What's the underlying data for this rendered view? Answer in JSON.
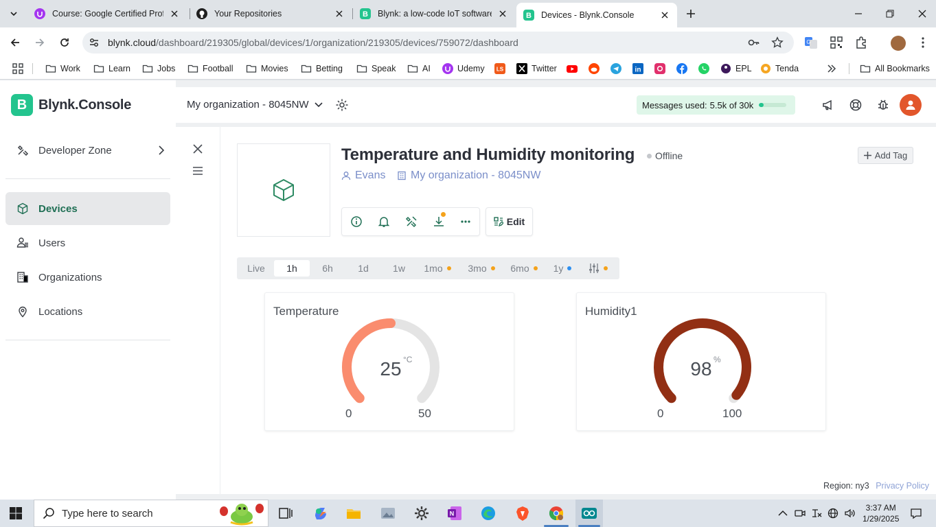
{
  "browser": {
    "tabs": [
      {
        "title": "Course: Google Certified Profes"
      },
      {
        "title": "Your Repositories"
      },
      {
        "title": "Blynk: a low-code IoT software p"
      },
      {
        "title": "Devices - Blynk.Console"
      }
    ],
    "url_host": "blynk.cloud",
    "url_path": "/dashboard/219305/global/devices/1/organization/219305/devices/759072/dashboard",
    "bookmarks": [
      "Work",
      "Learn",
      "Jobs",
      "Football",
      "Movies",
      "Betting",
      "Speak",
      "AI",
      "Udemy",
      "Twitter",
      "EPL",
      "Tenda"
    ],
    "all_bookmarks": "All Bookmarks"
  },
  "app": {
    "brand": "Blynk.Console",
    "org_name": "My organization - 8045NW",
    "messages_label": "Messages used:",
    "messages_value": "5.5k of 30k",
    "messages_fraction": 0.18,
    "sidebar": {
      "developer_zone": "Developer Zone",
      "items": [
        "Devices",
        "Users",
        "Organizations",
        "Locations"
      ]
    },
    "device": {
      "title": "Temperature and Humidity monitoring",
      "status": "Offline",
      "owner": "Evans",
      "organization": "My organization - 8045NW",
      "add_tag": "Add Tag",
      "edit": "Edit"
    },
    "time_ranges": [
      "Live",
      "1h",
      "6h",
      "1d",
      "1w",
      "1mo",
      "3mo",
      "6mo",
      "1y"
    ],
    "active_range": "1h",
    "widgets": [
      {
        "title": "Temperature",
        "value": "25",
        "unit": "°C",
        "min": "0",
        "max": "50",
        "color": "#fa8c6e"
      },
      {
        "title": "Humidity1",
        "value": "98",
        "unit": "%",
        "min": "0",
        "max": "100",
        "color": "#922f14"
      }
    ],
    "footer": {
      "region": "Region: ny3",
      "privacy": "Privacy Policy"
    }
  },
  "taskbar": {
    "search_placeholder": "Type here to search",
    "time": "3:37 AM",
    "date": "1/29/2025"
  }
}
